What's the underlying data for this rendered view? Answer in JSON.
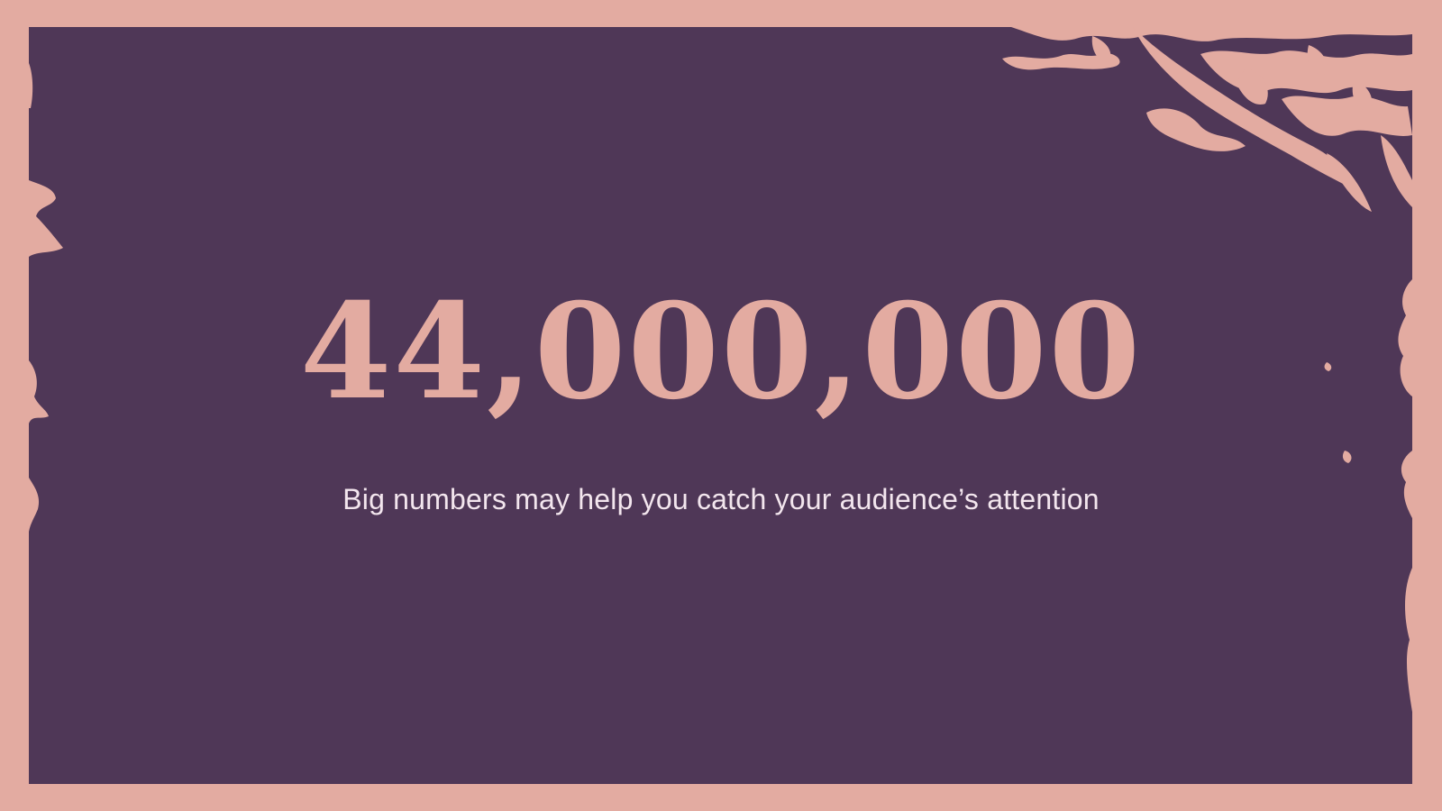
{
  "slide": {
    "big_number": "44,000,000",
    "subtitle": "Big numbers may help you catch your audience’s attention"
  },
  "colors": {
    "background_frame": "#E3ABA1",
    "panel": "#4F3757",
    "accent": "#E3ABA1",
    "subtitle_text": "#F3E6EE"
  }
}
